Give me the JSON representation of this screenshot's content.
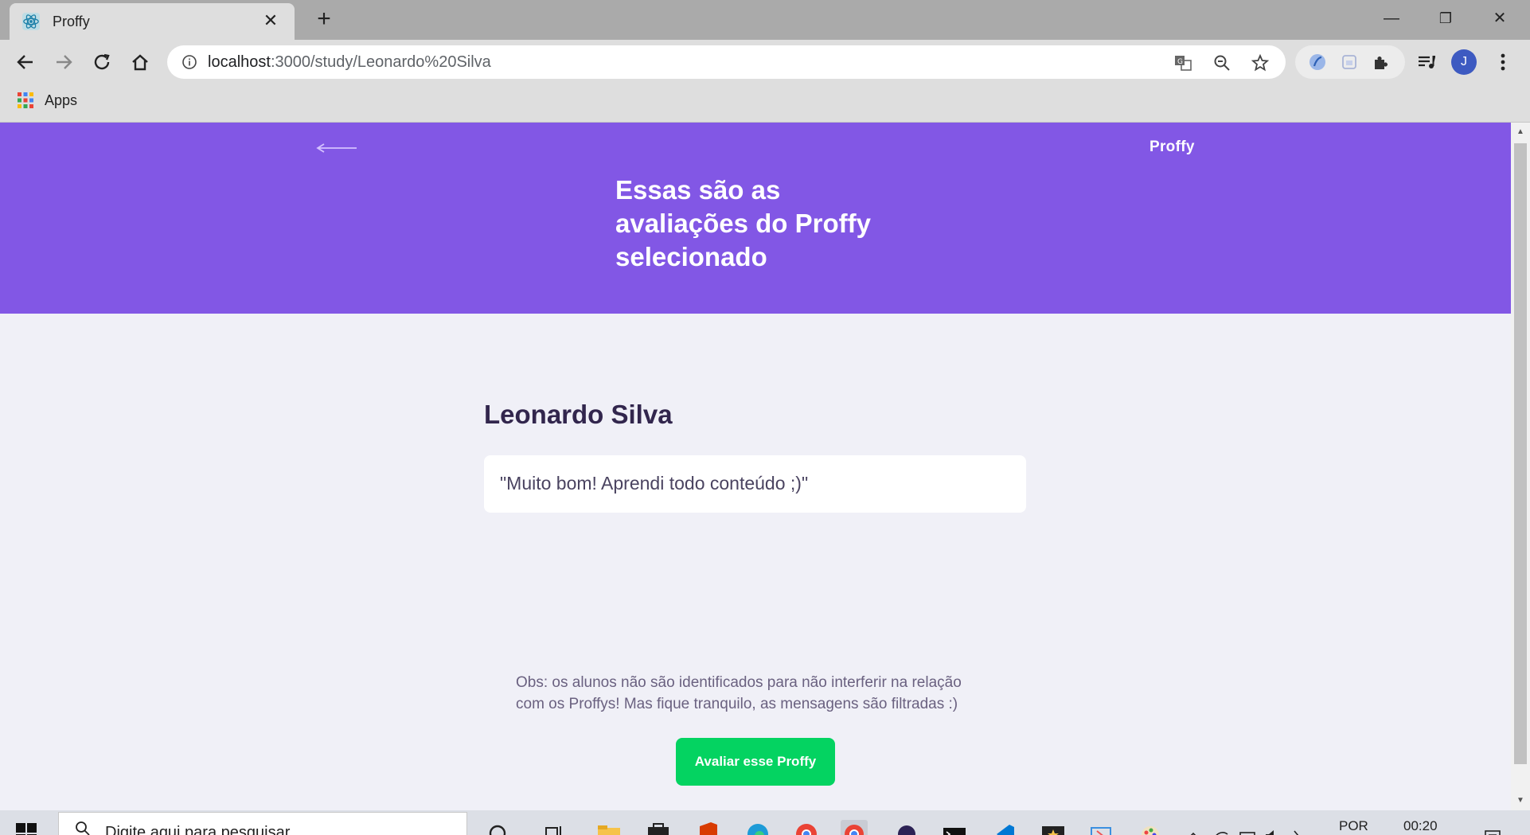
{
  "browser": {
    "tab_title": "Proffy",
    "url_host": "localhost",
    "url_path": ":3000/study/Leonardo%20Silva",
    "bookmark_apps": "Apps",
    "profile_initial": "J"
  },
  "hero": {
    "brand": "Proffy",
    "title": "Essas são as avaliações do Proffy selecionado"
  },
  "main": {
    "teacher_name": "Leonardo Silva",
    "review": "\"Muito bom! Aprendi todo conteúdo ;)\"",
    "note": "Obs: os alunos não são identificados para não interferir na relação com os Proffys! Mas fique tranquilo, as mensagens são filtradas :)",
    "rate_button": "Avaliar esse Proffy"
  },
  "taskbar": {
    "search_placeholder": "Digite aqui para pesquisar",
    "language": "POR",
    "time": "00:20"
  },
  "colors": {
    "primary": "#8257e5",
    "secondary": "#04d361",
    "background": "#f0f0f7",
    "title_text": "#32264d"
  }
}
